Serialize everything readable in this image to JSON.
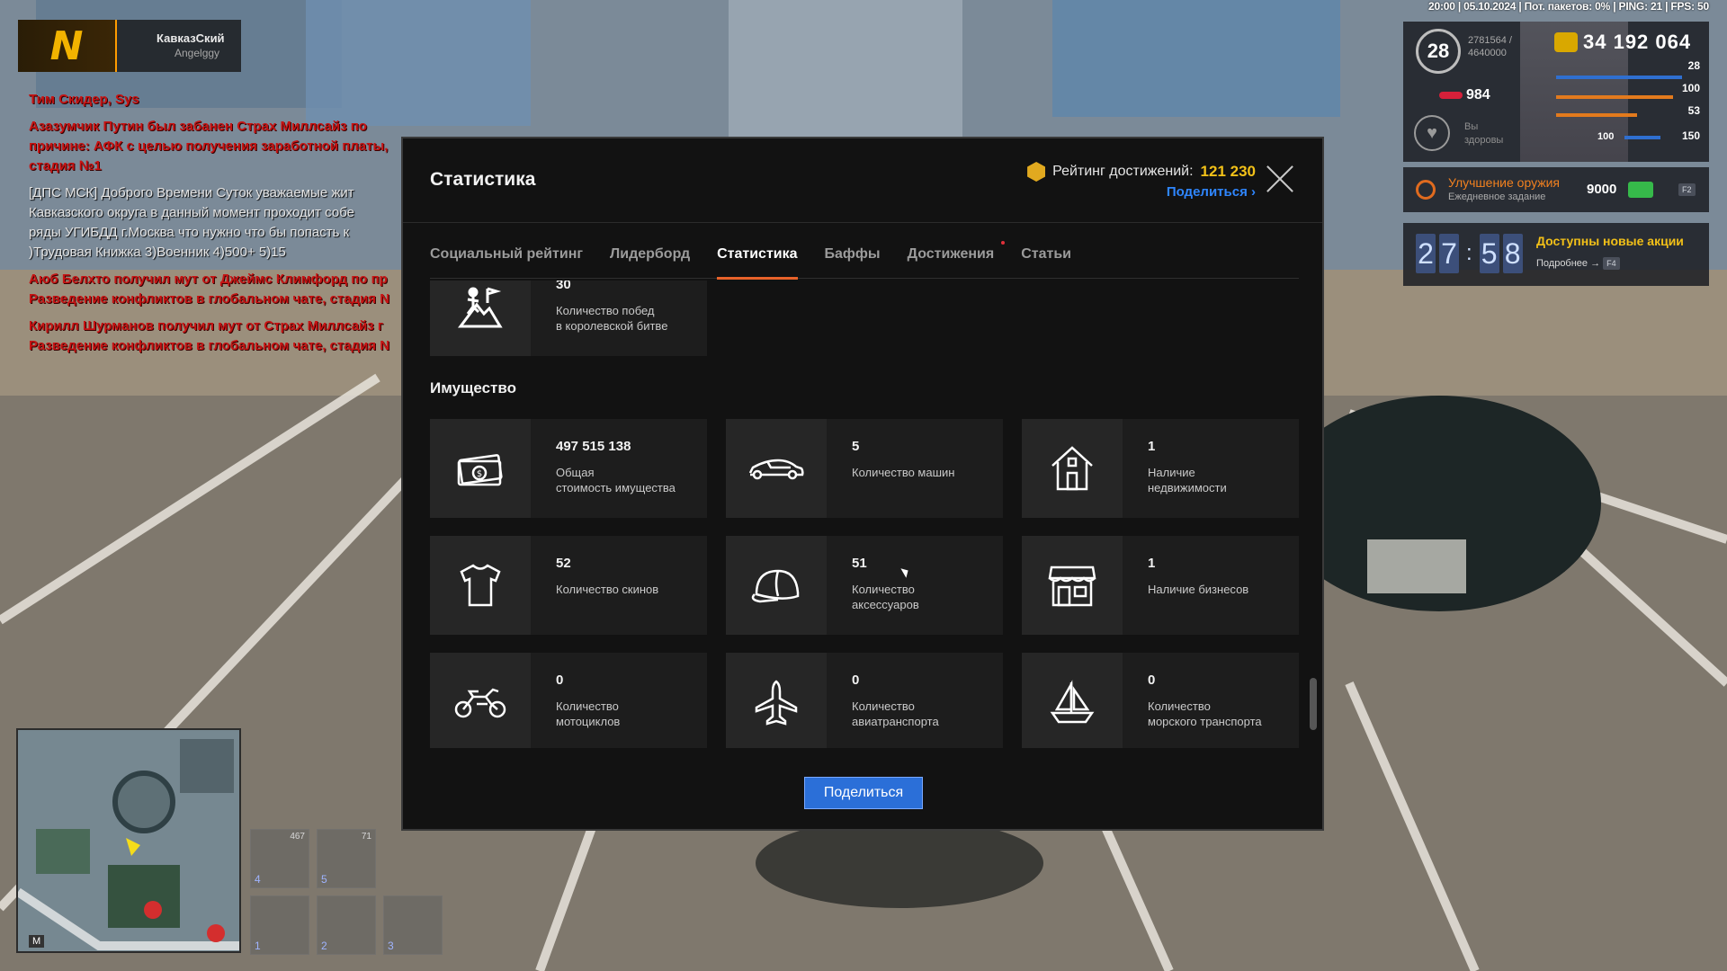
{
  "server": {
    "logo_letter": "N",
    "server_name": "КавказСкий",
    "player_name": "Angelggy"
  },
  "chat": [
    {
      "type": "red",
      "text": "Тим Скидер, Sys"
    },
    {
      "type": "red",
      "text": "Азазумчик Путин был забанен Страх Миллсайз по причине: АФК с целью получения заработной платы, стадия №1"
    },
    {
      "type": "gray",
      "text": "[ДПС МСК] Доброго Времени Суток уважаемые жит\nКавказского округа в данный момент проходит собе\nряды УГИБДД г.Москва что нужно что бы попасть к\n)Трудовая Книжка 3)Военник 4)500+ 5)15"
    },
    {
      "type": "red",
      "text": "Аюб Белхто получил мут от Джеймс Климфорд по пр\nРазведение конфликтов в глобальном чате, стадия N"
    },
    {
      "type": "red",
      "text": "Кирилл Шурманов получил мут от Страх Миллсайз г\nРазведение конфликтов в глобальном чате, стадия N"
    }
  ],
  "hud": {
    "top_info": "20:00 | 05.10.2024 | Пот. пакетов: 0% | PING: 21 | FPS: 50",
    "level": "28",
    "xp": "2781564 /",
    "xp_max": "4640000",
    "money": "34 192 064",
    "hunger": "984",
    "health_label": "Вы\nздоровы",
    "stats": [
      "28",
      "100",
      "53",
      "150"
    ],
    "armor_val": "100",
    "quest_title": "Улучшение оружия",
    "quest_sub": "Ежедневное задание",
    "quest_value": "9000",
    "quest_key": "F2",
    "timer": {
      "m1": "2",
      "m2": "7",
      "s1": "5",
      "s2": "8"
    },
    "promo_title": "Доступны новые акции",
    "promo_sub": "Подробнее",
    "promo_key": "F4"
  },
  "minimap": {
    "key": "M"
  },
  "hotbar": [
    {
      "num": "4",
      "count": "467"
    },
    {
      "num": "5",
      "count": "71"
    },
    {
      "num": "1",
      "count": ""
    },
    {
      "num": "2",
      "count": ""
    },
    {
      "num": "3",
      "count": ""
    }
  ],
  "modal": {
    "title": "Статистика",
    "rating_label": "Рейтинг достижений:",
    "rating_value": "121 230",
    "rating_share": "Поделиться ›",
    "tabs": [
      "Социальный рейтинг",
      "Лидерборд",
      "Статистика",
      "Баффы",
      "Достижения",
      "Статьи"
    ],
    "active_tab": "Статистика",
    "top_card": {
      "value": "30",
      "label": "Количество побед\nв королевской битве"
    },
    "section_title": "Имущество",
    "cards": [
      {
        "icon": "money-icon",
        "value": "497 515 138",
        "label": "Общая\nстоимость имущества"
      },
      {
        "icon": "car-icon",
        "value": "5",
        "label": "Количество машин"
      },
      {
        "icon": "house-icon",
        "value": "1",
        "label": "Наличие\nнедвижимости"
      },
      {
        "icon": "tshirt-icon",
        "value": "52",
        "label": "Количество скинов"
      },
      {
        "icon": "cap-icon",
        "value": "51",
        "label": "Количество\nаксессуаров"
      },
      {
        "icon": "shop-icon",
        "value": "1",
        "label": "Наличие бизнесов"
      },
      {
        "icon": "motorcycle-icon",
        "value": "0",
        "label": "Количество\nмотоциклов"
      },
      {
        "icon": "plane-icon",
        "value": "0",
        "label": "Количество\nавиатранспорта"
      },
      {
        "icon": "boat-icon",
        "value": "0",
        "label": "Количество\nморского транспорта"
      }
    ],
    "share_button": "Поделиться"
  },
  "colors": {
    "accent_orange": "#e8622a",
    "gold": "#f2c118",
    "link_blue": "#2f86ff",
    "button_blue": "#2b6fd8"
  }
}
